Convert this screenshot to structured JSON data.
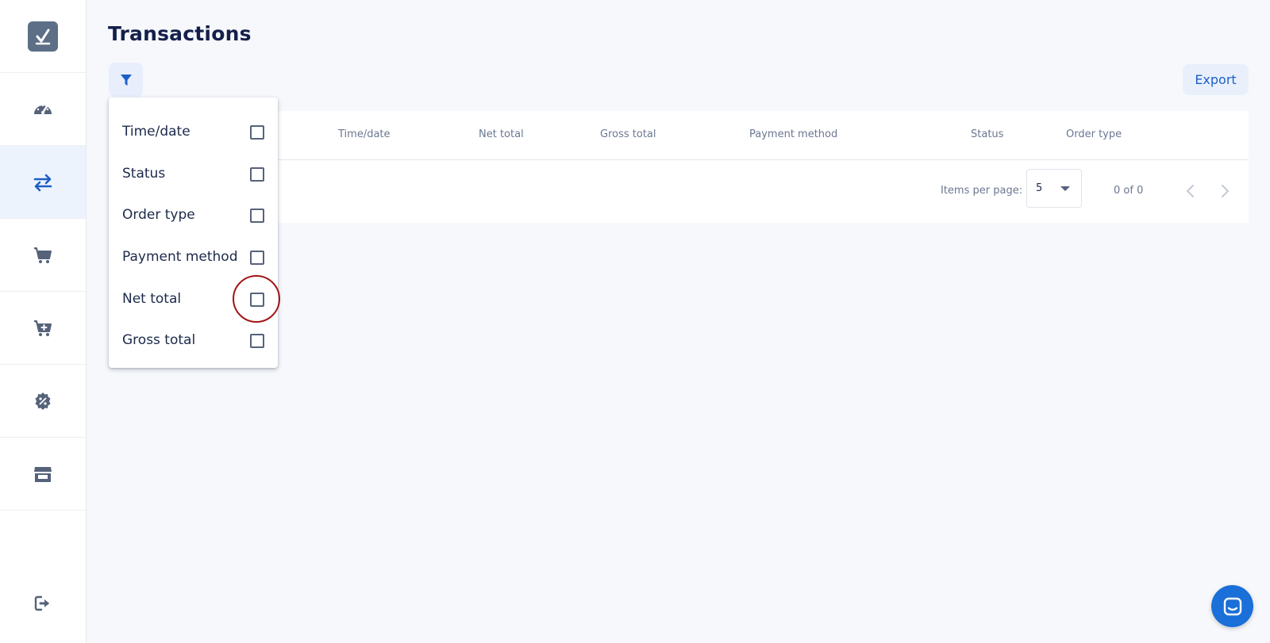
{
  "page": {
    "title": "Transactions"
  },
  "toolbar": {
    "export_label": "Export"
  },
  "sidebar": {
    "items": [
      {
        "name": "dashboard",
        "icon": "speedometer-icon",
        "active": false
      },
      {
        "name": "transactions",
        "icon": "swap-arrows-icon",
        "active": true
      },
      {
        "name": "orders",
        "icon": "cart-icon",
        "active": false
      },
      {
        "name": "new-order",
        "icon": "cart-plus-icon",
        "active": false
      },
      {
        "name": "discounts",
        "icon": "percent-badge-icon",
        "active": false
      },
      {
        "name": "store",
        "icon": "store-icon",
        "active": false
      }
    ],
    "logout_icon": "logout-icon"
  },
  "table": {
    "columns": [
      "Time/date",
      "Net total",
      "Gross total",
      "Payment method",
      "Status",
      "Order type"
    ],
    "rows": []
  },
  "pagination": {
    "items_per_page_label": "Items per page:",
    "items_per_page_value": "5",
    "range_label": "0 of 0"
  },
  "column_menu": {
    "items": [
      {
        "label": "Time/date",
        "checked": false
      },
      {
        "label": "Status",
        "checked": false
      },
      {
        "label": "Order type",
        "checked": false
      },
      {
        "label": "Payment method",
        "checked": false
      },
      {
        "label": "Net total",
        "checked": false
      },
      {
        "label": "Gross total",
        "checked": false
      }
    ]
  },
  "colors": {
    "accent": "#1d5fc7",
    "sidebar_icon": "#56627a",
    "active_bg": "#edf3fd",
    "highlight": "#a31515"
  }
}
